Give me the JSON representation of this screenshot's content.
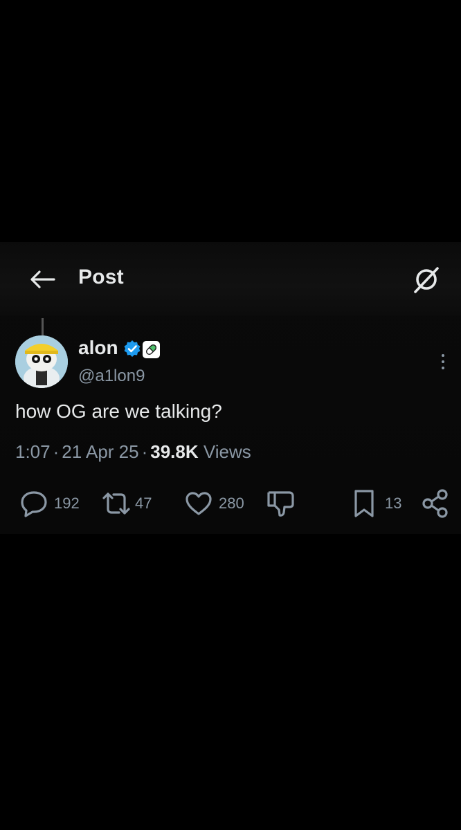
{
  "header": {
    "title": "Post"
  },
  "post": {
    "author_name": "alon",
    "handle": "@a1lon9",
    "text": "how OG are we talking?",
    "time": "1:07",
    "date": "21 Apr 25",
    "views_count": "39.8K",
    "views_label": "Views"
  },
  "actions": {
    "replies": "192",
    "reposts": "47",
    "likes": "280",
    "bookmarks": "13"
  },
  "colors": {
    "background": "#000000",
    "text": "#e7e9ea",
    "secondary": "#8b98a5",
    "verified": "#1d9bf0"
  },
  "icons": [
    "back-arrow-icon",
    "grok-icon",
    "verified-icon",
    "pill-icon",
    "more-icon",
    "reply-icon",
    "repost-icon",
    "like-icon",
    "dislike-icon",
    "bookmark-icon",
    "share-icon"
  ]
}
